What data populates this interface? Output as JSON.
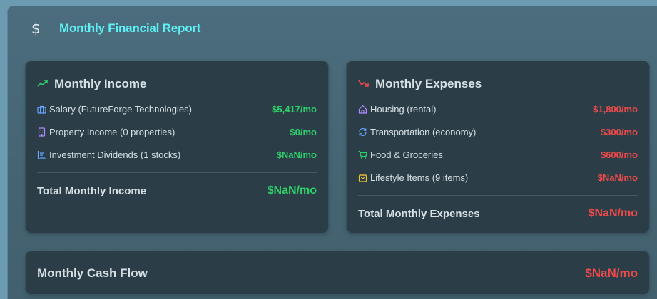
{
  "header": {
    "title": "Monthly Financial Report",
    "icon": "dollar-icon"
  },
  "income": {
    "title": "Monthly Income",
    "items": [
      {
        "label": "Salary (FutureForge Technologies)",
        "value": "$5,417/mo",
        "icon": "briefcase-icon"
      },
      {
        "label": "Property Income (0 properties)",
        "value": "$0/mo",
        "icon": "building-icon"
      },
      {
        "label": "Investment Dividends (1 stocks)",
        "value": "$NaN/mo",
        "icon": "bar-chart-icon"
      }
    ],
    "total_label": "Total Monthly Income",
    "total_value": "$NaN/mo"
  },
  "expenses": {
    "title": "Monthly Expenses",
    "items": [
      {
        "label": "Housing (rental)",
        "value": "$1,800/mo",
        "icon": "home-icon"
      },
      {
        "label": "Transportation (economy)",
        "value": "$300/mo",
        "icon": "refresh-icon"
      },
      {
        "label": "Food & Groceries",
        "value": "$600/mo",
        "icon": "cart-icon"
      },
      {
        "label": "Lifestyle Items (9 items)",
        "value": "$NaN/mo",
        "icon": "bag-icon"
      }
    ],
    "total_label": "Total Monthly Expenses",
    "total_value": "$NaN/mo"
  },
  "cashflow": {
    "label": "Monthly Cash Flow",
    "value": "$NaN/mo"
  },
  "colors": {
    "positive": "#2ed06a",
    "negative": "#ef4a4a",
    "accent": "#5ef0f5"
  }
}
